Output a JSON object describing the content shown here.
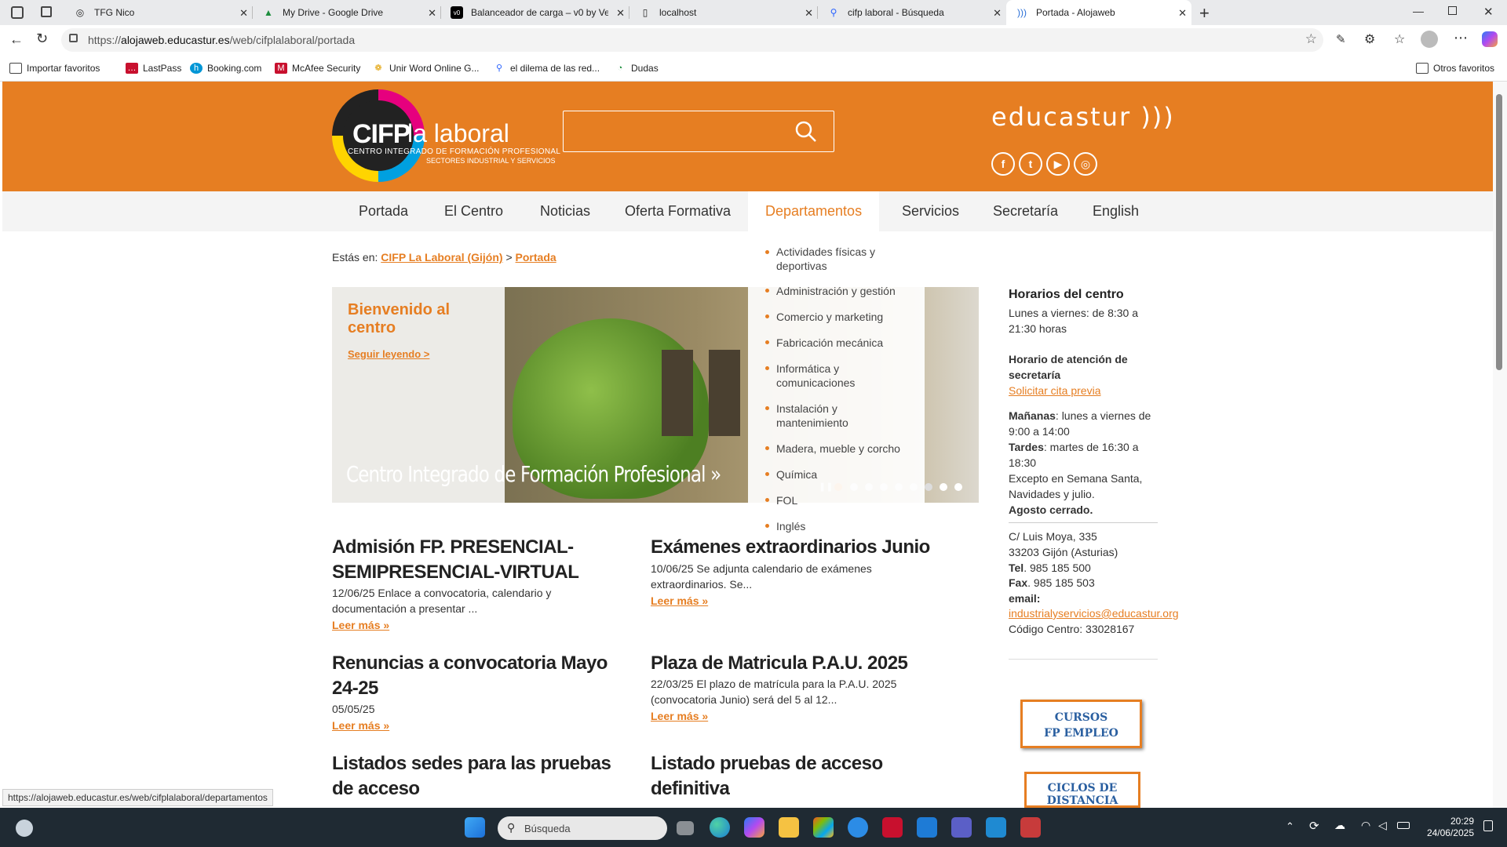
{
  "browser": {
    "tabs": [
      {
        "title": "TFG Nico"
      },
      {
        "title": "My Drive - Google Drive"
      },
      {
        "title": "Balanceador de carga – v0 by Vercel"
      },
      {
        "title": "localhost"
      },
      {
        "title": "cifp laboral - Búsqueda"
      },
      {
        "title": "Portada - Alojaweb"
      }
    ],
    "url_prefix": "https://",
    "url_host": "alojaweb.educastur.es",
    "url_path": "/web/cifplalaboral/portada",
    "favorites": [
      "Importar favoritos",
      "LastPass",
      "Booking.com",
      "McAfee Security",
      "Unir Word Online G...",
      "el dilema de las red...",
      "Dudas"
    ],
    "other_favorites": "Otros favoritos",
    "status_url": "https://alojaweb.educastur.es/web/cifplalaboral/departamentos"
  },
  "header": {
    "logo_cifp": "CIFP",
    "logo_name": "la laboral",
    "logo_sub1": "CENTRO INTEGRADO DE FORMACIÓN PROFESIONAL",
    "logo_sub2": "SECTORES INDUSTRIAL Y SERVICIOS",
    "educastur": "educastur )))",
    "social": [
      "facebook-icon",
      "twitter-icon",
      "youtube-icon",
      "instagram-icon"
    ]
  },
  "nav": [
    "Portada",
    "El Centro",
    "Noticias",
    "Oferta Formativa",
    "Departamentos",
    "Servicios",
    "Secretaría",
    "English"
  ],
  "breadcrumb": {
    "prefix": "Estás en:",
    "crumb1": "CIFP La Laboral (Gijón)",
    "sep": ">",
    "crumb2": "Portada"
  },
  "slider": {
    "title": "Bienvenido al centro",
    "more": "Seguir leyendo >",
    "caption": "Centro Integrado de Formación Profesional »"
  },
  "departments": [
    "Actividades físicas y deportivas",
    "Administración y gestión",
    "Comercio y marketing",
    "Fabricación mecánica",
    "Informática y comunicaciones",
    "Instalación y mantenimiento",
    "Madera, mueble y corcho",
    "Química",
    "FOL",
    "Inglés"
  ],
  "news": [
    {
      "title": "Admisión FP. PRESENCIAL-SEMIPRESENCIAL-VIRTUAL",
      "body": "12/06/25 Enlace a convocatoria, calendario y documentación a presentar ...",
      "more": "Leer más »"
    },
    {
      "title": "Exámenes extraordinarios Junio",
      "body": "10/06/25 Se adjunta calendario de exámenes extraordinarios.   Se...",
      "more": "Leer más »"
    },
    {
      "title": "Renuncias a convocatoria Mayo 24-25",
      "body": "05/05/25",
      "more": "Leer más »"
    },
    {
      "title": "Plaza de Matricula P.A.U. 2025",
      "body": "22/03/25 El plazo de matrícula para la P.A.U. 2025 (convocatoria Junio) será del 5 al 12...",
      "more": "Leer más »"
    },
    {
      "title": "Listados sedes para las pruebas de acceso",
      "body": "",
      "more": ""
    },
    {
      "title": "Listado pruebas de acceso definitiva",
      "body": "",
      "more": ""
    }
  ],
  "sidebar": {
    "h1": "Horarios del centro",
    "h1_text": "Lunes a viernes: de 8:30 a 21:30 horas",
    "h2": "Horario de atención de secretaría",
    "cita": "Solicitar cita previa",
    "mananas_label": "Mañanas",
    "mananas": ": lunes a viernes de 9:00 a 14:00",
    "tardes_label": "Tardes",
    "tardes": ": martes de 16:30 a 18:30",
    "excepto": "Excepto en Semana Santa, Navidades y julio.",
    "agosto": "Agosto cerrado.",
    "addr1": "C/ Luis Moya, 335",
    "addr2": "33203 Gijón (Asturias)",
    "tel_label": "Tel",
    "tel": ". 985 185 500",
    "fax_label": "Fax",
    "fax": ". 985 185 503",
    "email_label": "email:",
    "email": "industrialyservicios@educastur.org",
    "codigo": "Código Centro: 33028167",
    "banner1_l1": "CURSOS",
    "banner1_l2": "FP EMPLEO",
    "banner2_l1": "CICLOS DE",
    "banner2_l2": "DISTANCIA"
  },
  "taskbar": {
    "search_placeholder": "Búsqueda",
    "time": "20:29",
    "date": "24/06/2025"
  }
}
